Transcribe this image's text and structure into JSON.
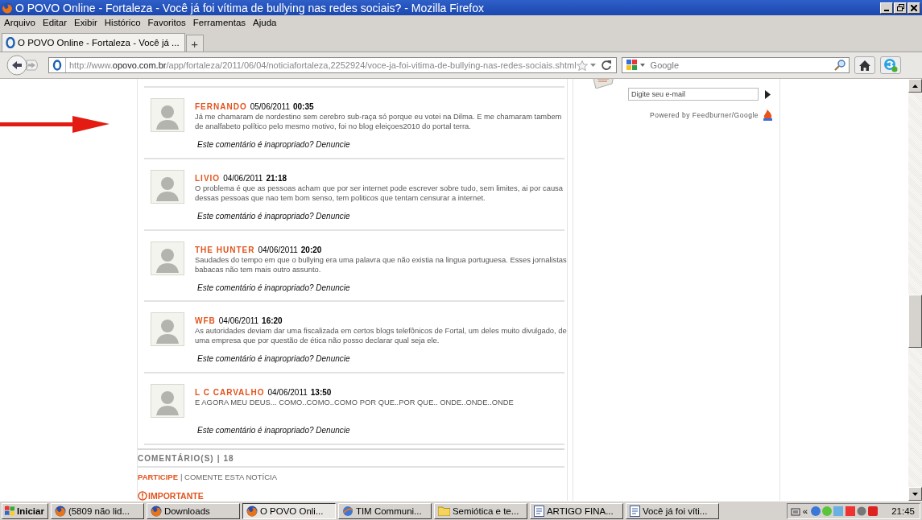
{
  "window": {
    "title": "O POVO Online - Fortaleza - Você já foi vítima de bullying nas redes sociais? - Mozilla Firefox"
  },
  "menu": [
    "Arquivo",
    "Editar",
    "Exibir",
    "Histórico",
    "Favoritos",
    "Ferramentas",
    "Ajuda"
  ],
  "tabs": [
    {
      "label": "O POVO Online - Fortaleza - Você já ...",
      "selected": true
    }
  ],
  "new_tab": "+",
  "address": {
    "prefix": "http://www.",
    "domain": "opovo.com.br",
    "path": "/app/fortaleza/2011/06/04/noticiafortaleza,2252924/voce-ja-foi-vitima-de-bullying-nas-redes-sociais.shtml"
  },
  "search": {
    "placeholder": "Google"
  },
  "comments": [
    {
      "name": "FERNANDO",
      "date": "05/06/2011",
      "time": "00:35",
      "text": "Já me chamaram de nordestino sem cerebro sub-raça só porque eu votei na Dilma. E me chamaram tambem de analfabeto político pelo mesmo motivo, foi no blog eleiçoes2010 do portal terra.",
      "report": "Este comentário é inapropriado? Denuncie"
    },
    {
      "name": "LIVIO",
      "date": "04/06/2011",
      "time": "21:18",
      "text": "O problema é que as pessoas acham que por ser internet pode escrever sobre tudo, sem limites, ai por causa dessas pessoas que nao tem bom senso, tem politicos que tentam censurar a internet.",
      "report": "Este comentário é inapropriado? Denuncie"
    },
    {
      "name": "THE HUNTER",
      "date": "04/06/2011",
      "time": "20:20",
      "text": "Saudades do tempo em que o bullying era uma palavra que não existia na lingua portuguesa. Esses jornalistas babacas não tem mais outro assunto.",
      "report": "Este comentário é inapropriado? Denuncie"
    },
    {
      "name": "WFB",
      "date": "04/06/2011",
      "time": "16:20",
      "text": "As autoridades deviam dar uma fiscalizada em certos blogs telefônicos de Fortal, um deles muito divulgado, de uma empresa que por questão de ética não posso declarar qual seja ele.",
      "report": "Este comentário é inapropriado? Denuncie"
    },
    {
      "name": "L C CARVALHO",
      "date": "04/06/2011",
      "time": "13:50",
      "text": "E AGORA MEU DEUS... COMO..COMO..COMO POR QUE..POR QUE.. ONDE..ONDE..ONDE",
      "report": "Este comentário é inapropriado? Denuncie"
    }
  ],
  "comment_count": {
    "label": "COMENTÁRIO(S)",
    "separator": "|",
    "count": "18"
  },
  "participate": {
    "link": "PARTICIPE",
    "text": "| COMENTE ESTA NOTÍCIA"
  },
  "important": "IMPORTANTE",
  "sidebar": {
    "email_placeholder": "Digite seu e-mail",
    "powered_by": "Powered by Feedburner/Google"
  },
  "taskbar": {
    "start": "Iniciar",
    "items": [
      {
        "label": "(5809 não lid...",
        "kind": "firefox",
        "selected": false
      },
      {
        "label": "Downloads",
        "kind": "firefox",
        "selected": false
      },
      {
        "label": "O POVO Onli...",
        "kind": "firefox",
        "selected": true
      },
      {
        "label": "TIM Communi...",
        "kind": "browser",
        "selected": false
      },
      {
        "label": "Semiótica e te...",
        "kind": "folder",
        "selected": false
      },
      {
        "label": "ARTIGO FINA...",
        "kind": "document",
        "selected": false
      },
      {
        "label": "Você já foi víti...",
        "kind": "document",
        "selected": false
      }
    ],
    "tray_expand": "«",
    "clock": "21:45"
  }
}
